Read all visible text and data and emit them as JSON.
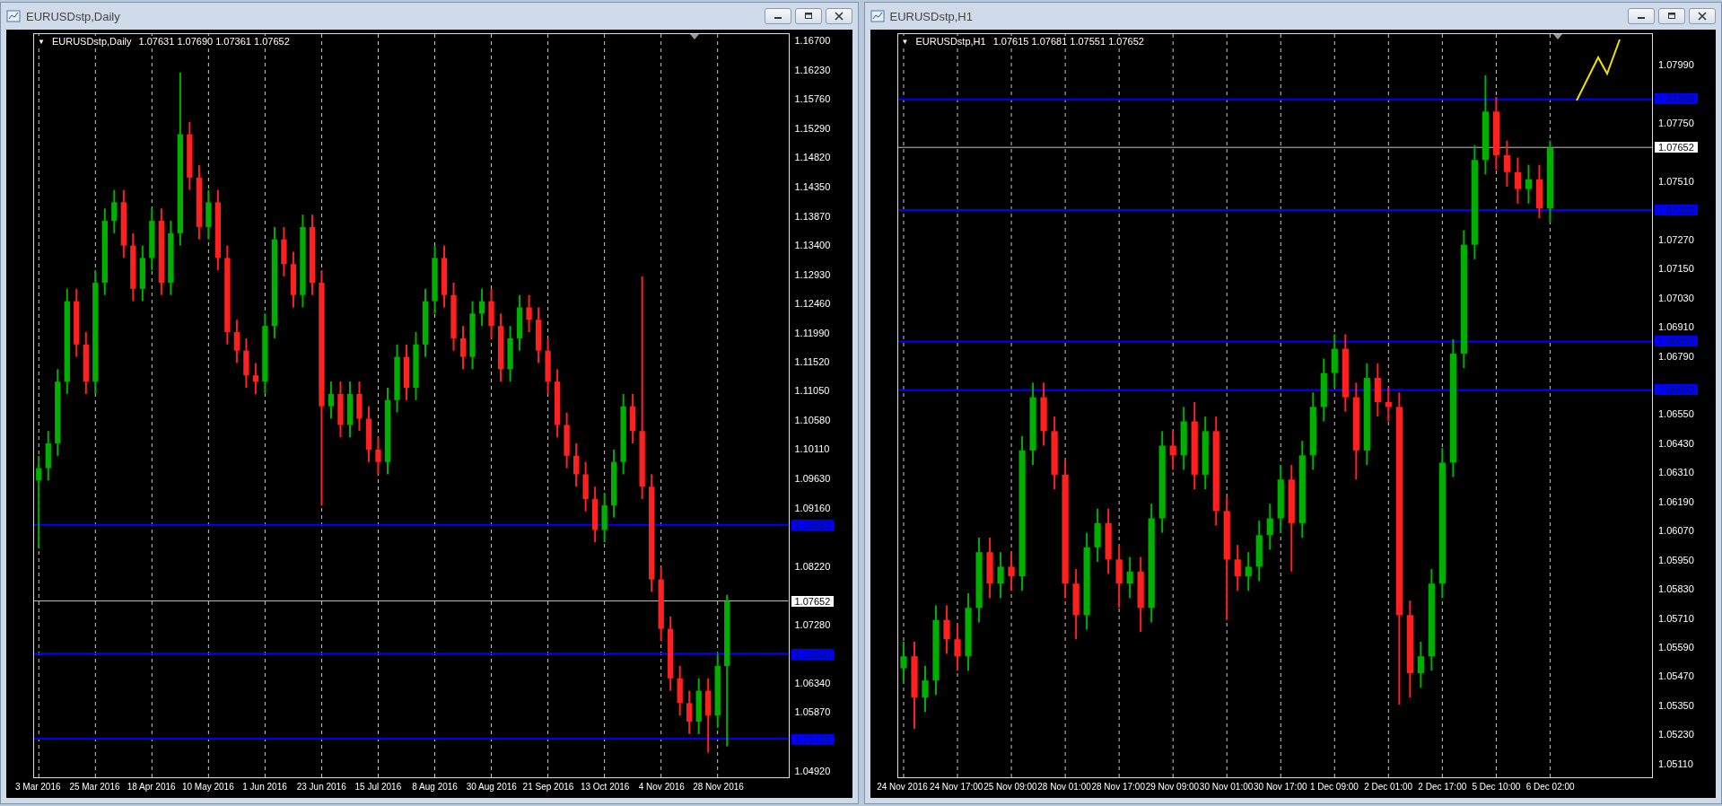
{
  "windows": [
    {
      "title": "EURUSDstp,Daily",
      "header": {
        "toggle": "▼",
        "symbol": "EURUSDstp,Daily",
        "ohlc": "1.07631 1.07690 1.07361 1.07652"
      },
      "chart_data": {
        "type": "candlestick",
        "grid": true,
        "ylim": [
          1.048,
          1.1682
        ],
        "yticks": [
          {
            "value": 1.167,
            "label": "1.16700"
          },
          {
            "value": 1.1623,
            "label": "1.16230"
          },
          {
            "value": 1.1576,
            "label": "1.15760"
          },
          {
            "value": 1.1529,
            "label": "1.15290"
          },
          {
            "value": 1.1482,
            "label": "1.14820"
          },
          {
            "value": 1.1435,
            "label": "1.14350"
          },
          {
            "value": 1.1387,
            "label": "1.13870"
          },
          {
            "value": 1.134,
            "label": "1.13400"
          },
          {
            "value": 1.1293,
            "label": "1.12930"
          },
          {
            "value": 1.1246,
            "label": "1.12460"
          },
          {
            "value": 1.1199,
            "label": "1.11990"
          },
          {
            "value": 1.1152,
            "label": "1.11520"
          },
          {
            "value": 1.1105,
            "label": "1.11050"
          },
          {
            "value": 1.1058,
            "label": "1.10580"
          },
          {
            "value": 1.1011,
            "label": "1.10110"
          },
          {
            "value": 1.0963,
            "label": "1.09630"
          },
          {
            "value": 1.0916,
            "label": "1.09160"
          },
          {
            "value": 1.0822,
            "label": "1.08220"
          },
          {
            "value": 1.0728,
            "label": "1.07280"
          },
          {
            "value": 1.0634,
            "label": "1.06340"
          },
          {
            "value": 1.0587,
            "label": "1.05870"
          },
          {
            "value": 1.0492,
            "label": "1.04920"
          }
        ],
        "categories": [
          "3 Mar 2016",
          null,
          null,
          null,
          null,
          null,
          "25 Mar 2016",
          null,
          null,
          null,
          null,
          null,
          "18 Apr 2016",
          null,
          null,
          null,
          null,
          null,
          "10 May 2016",
          null,
          null,
          null,
          null,
          null,
          "1 Jun 2016",
          null,
          null,
          null,
          null,
          null,
          "23 Jun 2016",
          null,
          null,
          null,
          null,
          null,
          "15 Jul 2016",
          null,
          null,
          null,
          null,
          null,
          "8 Aug 2016",
          null,
          null,
          null,
          null,
          null,
          "30 Aug 2016",
          null,
          null,
          null,
          null,
          null,
          "21 Sep 2016",
          null,
          null,
          null,
          null,
          null,
          "13 Oct 2016",
          null,
          null,
          null,
          null,
          null,
          "4 Nov 2016",
          null,
          null,
          null,
          null,
          null,
          "28 Nov 2016",
          null,
          null,
          null,
          null,
          null,
          null,
          null
        ],
        "ohlc": [
          [
            1.096,
            1.1,
            1.085,
            1.098
          ],
          [
            1.098,
            1.104,
            1.096,
            1.102
          ],
          [
            1.102,
            1.114,
            1.1,
            1.112
          ],
          [
            1.112,
            1.127,
            1.11,
            1.125
          ],
          [
            1.125,
            1.127,
            1.116,
            1.118
          ],
          [
            1.118,
            1.12,
            1.11,
            1.112
          ],
          [
            1.112,
            1.13,
            1.11,
            1.128
          ],
          [
            1.128,
            1.14,
            1.126,
            1.138
          ],
          [
            1.138,
            1.143,
            1.136,
            1.141
          ],
          [
            1.141,
            1.143,
            1.132,
            1.134
          ],
          [
            1.134,
            1.136,
            1.125,
            1.127
          ],
          [
            1.127,
            1.134,
            1.125,
            1.132
          ],
          [
            1.132,
            1.14,
            1.13,
            1.138
          ],
          [
            1.138,
            1.14,
            1.126,
            1.128
          ],
          [
            1.128,
            1.138,
            1.126,
            1.136
          ],
          [
            1.136,
            1.162,
            1.134,
            1.152
          ],
          [
            1.152,
            1.154,
            1.143,
            1.145
          ],
          [
            1.145,
            1.147,
            1.135,
            1.137
          ],
          [
            1.137,
            1.143,
            1.135,
            1.141
          ],
          [
            1.141,
            1.143,
            1.13,
            1.132
          ],
          [
            1.132,
            1.134,
            1.118,
            1.12
          ],
          [
            1.12,
            1.122,
            1.115,
            1.117
          ],
          [
            1.117,
            1.119,
            1.111,
            1.113
          ],
          [
            1.113,
            1.115,
            1.11,
            1.112
          ],
          [
            1.112,
            1.123,
            1.11,
            1.121
          ],
          [
            1.121,
            1.137,
            1.119,
            1.135
          ],
          [
            1.135,
            1.137,
            1.129,
            1.131
          ],
          [
            1.131,
            1.133,
            1.124,
            1.126
          ],
          [
            1.126,
            1.139,
            1.124,
            1.137
          ],
          [
            1.137,
            1.139,
            1.126,
            1.128
          ],
          [
            1.128,
            1.13,
            1.092,
            1.108
          ],
          [
            1.108,
            1.112,
            1.106,
            1.11
          ],
          [
            1.11,
            1.112,
            1.103,
            1.105
          ],
          [
            1.105,
            1.112,
            1.103,
            1.11
          ],
          [
            1.11,
            1.112,
            1.104,
            1.106
          ],
          [
            1.106,
            1.108,
            1.099,
            1.101
          ],
          [
            1.101,
            1.103,
            1.097,
            1.099
          ],
          [
            1.099,
            1.111,
            1.097,
            1.109
          ],
          [
            1.109,
            1.118,
            1.107,
            1.116
          ],
          [
            1.116,
            1.118,
            1.109,
            1.111
          ],
          [
            1.111,
            1.12,
            1.109,
            1.118
          ],
          [
            1.118,
            1.127,
            1.116,
            1.125
          ],
          [
            1.125,
            1.134,
            1.123,
            1.132
          ],
          [
            1.132,
            1.134,
            1.124,
            1.126
          ],
          [
            1.126,
            1.128,
            1.117,
            1.119
          ],
          [
            1.119,
            1.121,
            1.114,
            1.116
          ],
          [
            1.116,
            1.125,
            1.114,
            1.123
          ],
          [
            1.123,
            1.127,
            1.121,
            1.125
          ],
          [
            1.125,
            1.127,
            1.119,
            1.121
          ],
          [
            1.121,
            1.123,
            1.112,
            1.114
          ],
          [
            1.114,
            1.121,
            1.112,
            1.119
          ],
          [
            1.119,
            1.126,
            1.117,
            1.124
          ],
          [
            1.124,
            1.126,
            1.12,
            1.122
          ],
          [
            1.122,
            1.124,
            1.115,
            1.117
          ],
          [
            1.117,
            1.119,
            1.11,
            1.112
          ],
          [
            1.112,
            1.114,
            1.103,
            1.105
          ],
          [
            1.105,
            1.107,
            1.098,
            1.1
          ],
          [
            1.1,
            1.102,
            1.095,
            1.097
          ],
          [
            1.097,
            1.099,
            1.091,
            1.093
          ],
          [
            1.093,
            1.095,
            1.086,
            1.088
          ],
          [
            1.088,
            1.094,
            1.086,
            1.092
          ],
          [
            1.092,
            1.101,
            1.09,
            1.099
          ],
          [
            1.099,
            1.11,
            1.097,
            1.108
          ],
          [
            1.108,
            1.11,
            1.102,
            1.104
          ],
          [
            1.104,
            1.129,
            1.093,
            1.095
          ],
          [
            1.095,
            1.097,
            1.078,
            1.08
          ],
          [
            1.08,
            1.082,
            1.07,
            1.072
          ],
          [
            1.072,
            1.074,
            1.062,
            1.064
          ],
          [
            1.064,
            1.066,
            1.058,
            1.06
          ],
          [
            1.06,
            1.062,
            1.055,
            1.057
          ],
          [
            1.057,
            1.064,
            1.055,
            1.062
          ],
          [
            1.062,
            1.064,
            1.052,
            1.058
          ],
          [
            1.058,
            1.068,
            1.056,
            1.066
          ],
          [
            1.066,
            1.0775,
            1.053,
            1.0765
          ],
          null,
          null,
          null,
          null,
          null,
          null
        ],
        "ref_lines": [
          {
            "axis": "y",
            "value": 1.08883,
            "label": "1.08883",
            "color": "#0000ff"
          },
          {
            "axis": "y",
            "value": 1.07652,
            "label": "1.07652",
            "color": "#c0c0c0"
          },
          {
            "axis": "y",
            "value": 1.068,
            "label": "1.06800",
            "color": "#0000ff"
          },
          {
            "axis": "y",
            "value": 1.05425,
            "label": "1.05425",
            "color": "#0000ff"
          }
        ]
      }
    },
    {
      "title": "EURUSDstp,H1",
      "header": {
        "toggle": "▼",
        "symbol": "EURUSDstp,H1",
        "ohlc": "1.07615 1.07681 1.07551 1.07652"
      },
      "chart_data": {
        "type": "candlestick",
        "grid": true,
        "ylim": [
          1.0505,
          1.0812
        ],
        "yticks": [
          {
            "value": 1.0799,
            "label": "1.07990"
          },
          {
            "value": 1.0775,
            "label": "1.07750"
          },
          {
            "value": 1.0751,
            "label": "1.07510"
          },
          {
            "value": 1.0727,
            "label": "1.07270"
          },
          {
            "value": 1.0715,
            "label": "1.07150"
          },
          {
            "value": 1.0703,
            "label": "1.07030"
          },
          {
            "value": 1.0691,
            "label": "1.06910"
          },
          {
            "value": 1.0679,
            "label": "1.06790"
          },
          {
            "value": 1.0655,
            "label": "1.06550"
          },
          {
            "value": 1.0643,
            "label": "1.06430"
          },
          {
            "value": 1.0631,
            "label": "1.06310"
          },
          {
            "value": 1.0619,
            "label": "1.06190"
          },
          {
            "value": 1.0607,
            "label": "1.06070"
          },
          {
            "value": 1.0595,
            "label": "1.05950"
          },
          {
            "value": 1.0583,
            "label": "1.05830"
          },
          {
            "value": 1.0571,
            "label": "1.05710"
          },
          {
            "value": 1.0559,
            "label": "1.05590"
          },
          {
            "value": 1.0547,
            "label": "1.05470"
          },
          {
            "value": 1.0535,
            "label": "1.05350"
          },
          {
            "value": 1.0523,
            "label": "1.05230"
          },
          {
            "value": 1.0511,
            "label": "1.05110"
          }
        ],
        "categories": [
          "24 Nov 2016",
          null,
          null,
          null,
          null,
          "24 Nov 17:00",
          null,
          null,
          null,
          null,
          "25 Nov 09:00",
          null,
          null,
          null,
          null,
          "28 Nov 01:00",
          null,
          null,
          null,
          null,
          "28 Nov 17:00",
          null,
          null,
          null,
          null,
          "29 Nov 09:00",
          null,
          null,
          null,
          null,
          "30 Nov 01:00",
          null,
          null,
          null,
          null,
          "30 Nov 17:00",
          null,
          null,
          null,
          null,
          "1 Dec 09:00",
          null,
          null,
          null,
          null,
          "2 Dec 01:00",
          null,
          null,
          null,
          null,
          "2 Dec 17:00",
          null,
          null,
          null,
          null,
          "5 Dec 10:00",
          null,
          null,
          null,
          null,
          "6 Dec 02:00",
          null,
          null,
          null,
          null,
          null,
          null,
          null,
          null,
          null
        ],
        "ohlc": [
          [
            1.055,
            1.0561,
            1.0544,
            1.0555
          ],
          [
            1.0555,
            1.0561,
            1.0525,
            1.0538
          ],
          [
            1.0538,
            1.0551,
            1.0532,
            1.0545
          ],
          [
            1.0545,
            1.0576,
            1.0539,
            1.057
          ],
          [
            1.057,
            1.0576,
            1.0556,
            1.0562
          ],
          [
            1.0562,
            1.0568,
            1.0549,
            1.0555
          ],
          [
            1.0555,
            1.0581,
            1.0549,
            1.0575
          ],
          [
            1.0575,
            1.0604,
            1.0569,
            1.0598
          ],
          [
            1.0598,
            1.0604,
            1.0579,
            1.0585
          ],
          [
            1.0585,
            1.0598,
            1.0579,
            1.0592
          ],
          [
            1.0592,
            1.0598,
            1.0582,
            1.0588
          ],
          [
            1.0588,
            1.0646,
            1.0582,
            1.064
          ],
          [
            1.064,
            1.0668,
            1.0634,
            1.0662
          ],
          [
            1.0662,
            1.0668,
            1.0642,
            1.0648
          ],
          [
            1.0648,
            1.0654,
            1.0624,
            1.063
          ],
          [
            1.063,
            1.0636,
            1.0579,
            1.0585
          ],
          [
            1.0585,
            1.0591,
            1.0562,
            1.0572
          ],
          [
            1.0572,
            1.0606,
            1.0566,
            1.06
          ],
          [
            1.06,
            1.0616,
            1.0594,
            1.061
          ],
          [
            1.061,
            1.0616,
            1.0589,
            1.0595
          ],
          [
            1.0595,
            1.0601,
            1.0575,
            1.0585
          ],
          [
            1.0585,
            1.0596,
            1.0579,
            1.059
          ],
          [
            1.059,
            1.0596,
            1.0565,
            1.0575
          ],
          [
            1.0575,
            1.0618,
            1.0569,
            1.0612
          ],
          [
            1.0612,
            1.0648,
            1.0606,
            1.0642
          ],
          [
            1.0642,
            1.0648,
            1.0632,
            1.0638
          ],
          [
            1.0638,
            1.0658,
            1.0632,
            1.0652
          ],
          [
            1.0652,
            1.066,
            1.0624,
            1.063
          ],
          [
            1.063,
            1.0654,
            1.0624,
            1.0648
          ],
          [
            1.0648,
            1.0654,
            1.0609,
            1.0615
          ],
          [
            1.0615,
            1.0621,
            1.057,
            1.0595
          ],
          [
            1.0595,
            1.0601,
            1.0582,
            1.0588
          ],
          [
            1.0588,
            1.0598,
            1.0582,
            1.0592
          ],
          [
            1.0592,
            1.0611,
            1.0586,
            1.0605
          ],
          [
            1.0605,
            1.0618,
            1.0599,
            1.0612
          ],
          [
            1.0612,
            1.0634,
            1.0606,
            1.0628
          ],
          [
            1.0628,
            1.0634,
            1.059,
            1.061
          ],
          [
            1.061,
            1.0644,
            1.0604,
            1.0638
          ],
          [
            1.0638,
            1.0664,
            1.0632,
            1.0658
          ],
          [
            1.0658,
            1.0678,
            1.0652,
            1.0672
          ],
          [
            1.0672,
            1.0688,
            1.0666,
            1.0682
          ],
          [
            1.0682,
            1.0688,
            1.0656,
            1.0662
          ],
          [
            1.0662,
            1.0668,
            1.0628,
            1.064
          ],
          [
            1.064,
            1.0676,
            1.0634,
            1.067
          ],
          [
            1.067,
            1.0676,
            1.0654,
            1.066
          ],
          [
            1.066,
            1.0666,
            1.0652,
            1.0658
          ],
          [
            1.0658,
            1.0664,
            1.0535,
            1.0572
          ],
          [
            1.0572,
            1.0578,
            1.0538,
            1.0548
          ],
          [
            1.0548,
            1.0561,
            1.0542,
            1.0555
          ],
          [
            1.0555,
            1.0591,
            1.0549,
            1.0585
          ],
          [
            1.0585,
            1.0641,
            1.0579,
            1.0635
          ],
          [
            1.0635,
            1.0686,
            1.0629,
            1.068
          ],
          [
            1.068,
            1.0731,
            1.0674,
            1.0725
          ],
          [
            1.0725,
            1.0766,
            1.0719,
            1.076
          ],
          [
            1.076,
            1.0795,
            1.0754,
            1.078
          ],
          [
            1.078,
            1.0786,
            1.0756,
            1.0762
          ],
          [
            1.0762,
            1.0768,
            1.0749,
            1.0755
          ],
          [
            1.0755,
            1.0761,
            1.0742,
            1.0748
          ],
          [
            1.0748,
            1.0758,
            1.0742,
            1.0752
          ],
          [
            1.0752,
            1.0758,
            1.0736,
            1.074
          ],
          [
            1.074,
            1.0768,
            1.0734,
            1.0765
          ],
          null,
          null,
          null,
          null,
          null,
          null,
          null,
          null,
          null
        ],
        "ref_lines": [
          {
            "axis": "y",
            "value": 1.0785,
            "label": "1.07850",
            "color": "#0000ff"
          },
          {
            "axis": "y",
            "value": 1.07652,
            "label": "1.07652",
            "color": "#c0c0c0"
          },
          {
            "axis": "y",
            "value": 1.07393,
            "label": "1.07393",
            "color": "#0000ff"
          },
          {
            "axis": "y",
            "value": 1.0685,
            "label": "1.06850",
            "color": "#0000ff"
          },
          {
            "axis": "y",
            "value": 1.0665,
            "label": "1.06650",
            "color": "#0000ff"
          }
        ]
      }
    }
  ]
}
